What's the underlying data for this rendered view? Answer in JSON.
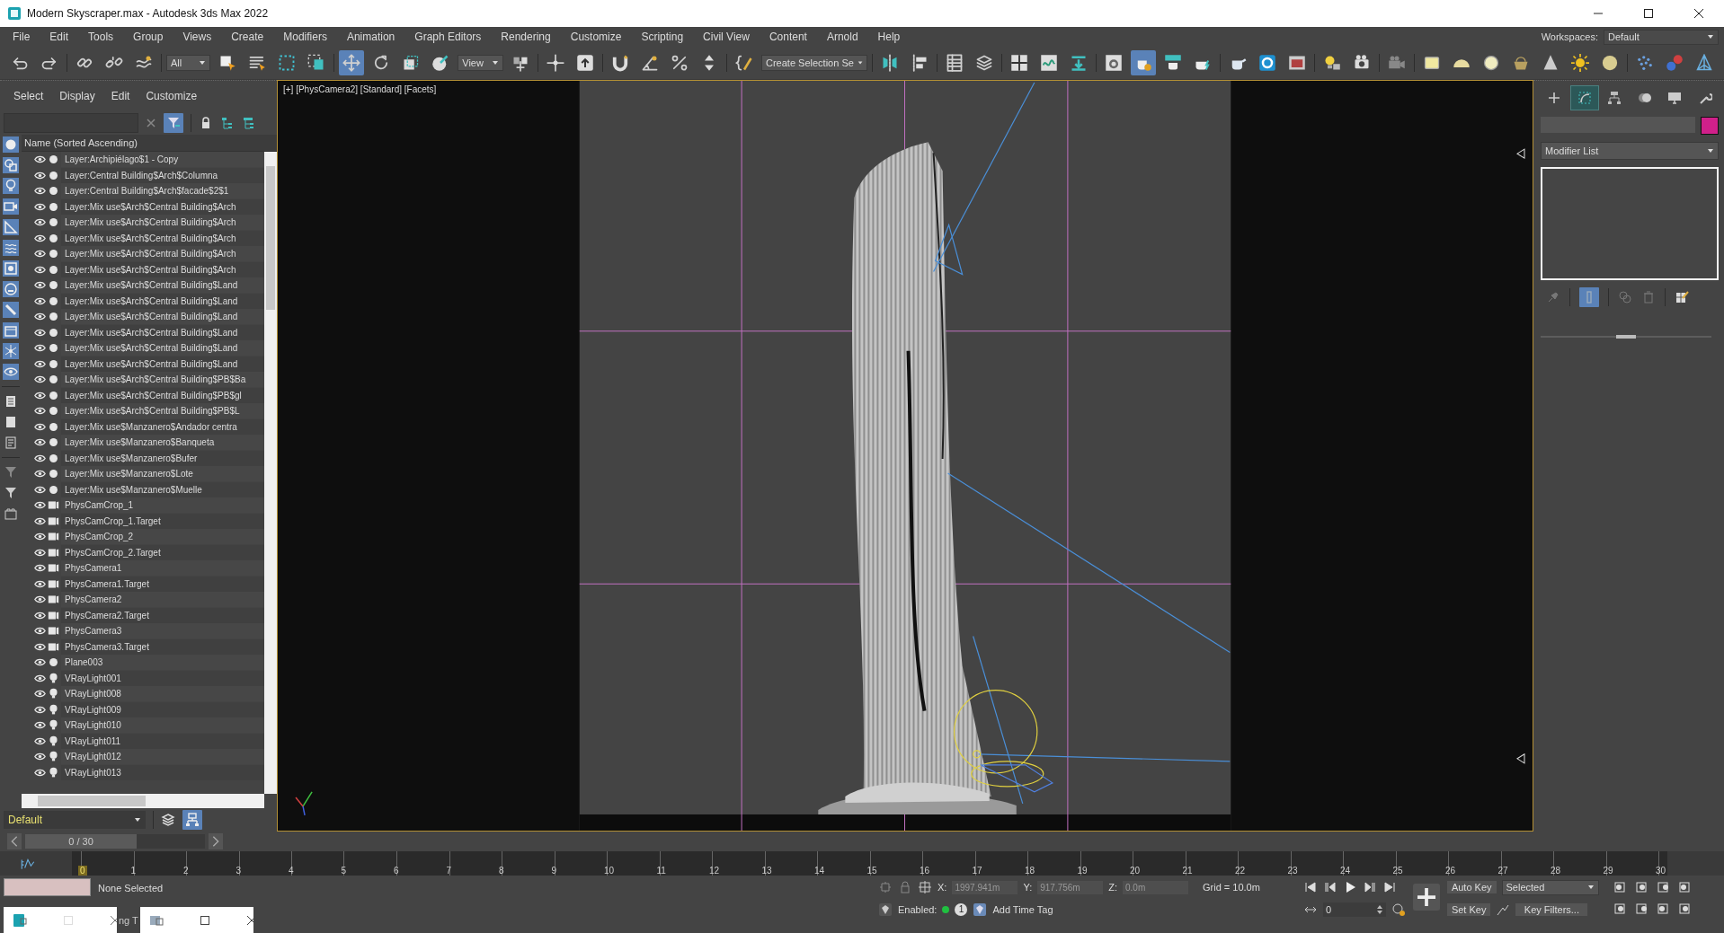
{
  "window": {
    "title": "Modern Skyscraper.max - Autodesk 3ds Max 2022"
  },
  "menu": [
    "File",
    "Edit",
    "Tools",
    "Group",
    "Views",
    "Create",
    "Modifiers",
    "Animation",
    "Graph Editors",
    "Rendering",
    "Customize",
    "Scripting",
    "Civil View",
    "Content",
    "Arnold",
    "Help"
  ],
  "workspaces": {
    "label": "Workspaces:",
    "value": "Default"
  },
  "toolbar": {
    "selection_filter": "All",
    "reference_coordinate": "View",
    "named_selection": "Create Selection Se",
    "move_tool": {
      "selected": true
    },
    "render_setup": {
      "selected": true
    }
  },
  "scene_explorer": {
    "menu": [
      "Select",
      "Display",
      "Edit",
      "Customize"
    ],
    "filter_button": {
      "selected": true
    },
    "filters": [
      {
        "on": true
      },
      {
        "on": true
      },
      {
        "on": true
      },
      {
        "on": true
      },
      {
        "on": true
      },
      {
        "on": true
      },
      {
        "on": true
      },
      {
        "on": true
      },
      {
        "on": true
      },
      {
        "on": true
      },
      {
        "on": true
      },
      {
        "on": true
      }
    ],
    "column": "Name (Sorted Ascending)",
    "rows": [
      {
        "name": "Layer:Archipiélago$1 - Copy",
        "kind": "layer"
      },
      {
        "name": "Layer:Central Building$Arch$Columna",
        "kind": "layer"
      },
      {
        "name": "Layer:Central Building$Arch$facade$2$1",
        "kind": "layer"
      },
      {
        "name": "Layer:Mix use$Arch$Central Building$Arch",
        "kind": "layer"
      },
      {
        "name": "Layer:Mix use$Arch$Central Building$Arch",
        "kind": "layer"
      },
      {
        "name": "Layer:Mix use$Arch$Central Building$Arch",
        "kind": "layer"
      },
      {
        "name": "Layer:Mix use$Arch$Central Building$Arch",
        "kind": "layer"
      },
      {
        "name": "Layer:Mix use$Arch$Central Building$Arch",
        "kind": "layer"
      },
      {
        "name": "Layer:Mix use$Arch$Central Building$Land",
        "kind": "layer"
      },
      {
        "name": "Layer:Mix use$Arch$Central Building$Land",
        "kind": "layer"
      },
      {
        "name": "Layer:Mix use$Arch$Central Building$Land",
        "kind": "layer"
      },
      {
        "name": "Layer:Mix use$Arch$Central Building$Land",
        "kind": "layer"
      },
      {
        "name": "Layer:Mix use$Arch$Central Building$Land",
        "kind": "layer"
      },
      {
        "name": "Layer:Mix use$Arch$Central Building$Land",
        "kind": "layer"
      },
      {
        "name": "Layer:Mix use$Arch$Central Building$PB$Ba",
        "kind": "layer"
      },
      {
        "name": "Layer:Mix use$Arch$Central Building$PB$gl",
        "kind": "layer"
      },
      {
        "name": "Layer:Mix use$Arch$Central Building$PB$L",
        "kind": "layer"
      },
      {
        "name": "Layer:Mix use$Manzanero$Andador centra",
        "kind": "layer"
      },
      {
        "name": "Layer:Mix use$Manzanero$Banqueta",
        "kind": "layer"
      },
      {
        "name": "Layer:Mix use$Manzanero$Bufer",
        "kind": "layer"
      },
      {
        "name": "Layer:Mix use$Manzanero$Lote",
        "kind": "layer"
      },
      {
        "name": "Layer:Mix use$Manzanero$Muelle",
        "kind": "layer"
      },
      {
        "name": "PhysCamCrop_1",
        "kind": "camera"
      },
      {
        "name": "PhysCamCrop_1.Target",
        "kind": "camera"
      },
      {
        "name": "PhysCamCrop_2",
        "kind": "camera"
      },
      {
        "name": "PhysCamCrop_2.Target",
        "kind": "camera"
      },
      {
        "name": "PhysCamera1",
        "kind": "camera"
      },
      {
        "name": "PhysCamera1.Target",
        "kind": "camera"
      },
      {
        "name": "PhysCamera2",
        "kind": "camera"
      },
      {
        "name": "PhysCamera2.Target",
        "kind": "camera"
      },
      {
        "name": "PhysCamera3",
        "kind": "camera"
      },
      {
        "name": "PhysCamera3.Target",
        "kind": "camera"
      },
      {
        "name": "Plane003",
        "kind": "layer"
      },
      {
        "name": "VRayLight001",
        "kind": "light"
      },
      {
        "name": "VRayLight008",
        "kind": "light"
      },
      {
        "name": "VRayLight009",
        "kind": "light"
      },
      {
        "name": "VRayLight010",
        "kind": "light"
      },
      {
        "name": "VRayLight011",
        "kind": "light"
      },
      {
        "name": "VRayLight012",
        "kind": "light"
      },
      {
        "name": "VRayLight013",
        "kind": "light"
      }
    ],
    "layer": "Default",
    "layer_view": {
      "selected": true
    }
  },
  "viewport": {
    "label": "[+] [PhysCamera2] [Standard] [Facets]"
  },
  "command_panel": {
    "tabs": [
      {
        "selected": false
      },
      {
        "selected": true
      },
      {
        "selected": false
      },
      {
        "selected": false
      },
      {
        "selected": false
      },
      {
        "selected": false
      }
    ],
    "modifier_list": "Modifier List",
    "show_end_result": {
      "selected": true
    }
  },
  "time_slider": {
    "text": "0 / 30",
    "level": 0
  },
  "timeline": {
    "frames": [
      "0",
      "1",
      "2",
      "3",
      "4",
      "5",
      "6",
      "7",
      "8",
      "9",
      "10",
      "11",
      "12",
      "13",
      "14",
      "15",
      "16",
      "17",
      "18",
      "19",
      "20",
      "21",
      "22",
      "23",
      "24",
      "25",
      "26",
      "27",
      "28",
      "29",
      "30"
    ]
  },
  "status": {
    "selection": "None Selected",
    "x_label": "X:",
    "x": "1997.941m",
    "y_label": "Y:",
    "y": "917.756m",
    "z_label": "Z:",
    "z": "0.0m",
    "grid": "Grid = 10.0m",
    "enabled": "Enabled:",
    "enabled_count": "1",
    "time_tag": "Add Time Tag",
    "auto_key": "Auto Key",
    "key_mode": "Selected",
    "set_key": "Set Key",
    "key_filters": "Key Filters...",
    "frame": "0"
  },
  "taskbar_preview": {
    "partial_text": "ng T"
  }
}
